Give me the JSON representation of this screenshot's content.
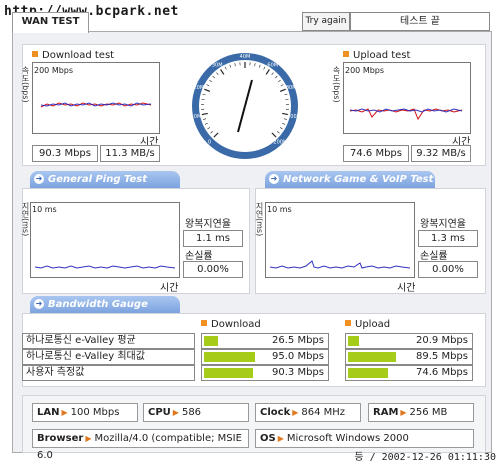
{
  "watermark": "http://www.bcpark.net",
  "tab": {
    "label": "WAN TEST"
  },
  "controls": {
    "retry": "Try again",
    "status": "테스트 끝"
  },
  "download": {
    "title": "Download test",
    "max": "200 Mbps",
    "axis_y": "속도(bps)",
    "axis_x": "시간",
    "mbps": "90.3 Mbps",
    "mbs": "11.3 MB/s"
  },
  "upload": {
    "title": "Upload test",
    "max": "200 Mbps",
    "axis_y": "속도(bps)",
    "axis_x": "시간",
    "mbps": "74.6 Mbps",
    "mbs": "9.32 MB/s"
  },
  "gauge": {
    "ticks": [
      "0",
      "10M",
      "20M",
      "30M",
      "40M",
      "60M",
      "80M",
      "100M",
      "200M"
    ]
  },
  "ping": {
    "title": "General Ping Test",
    "max": "10 ms",
    "axis_y": "지연(ms)",
    "axis_x": "시간",
    "rtt_label": "왕복지연율",
    "rtt": "1.1 ms",
    "loss_label": "손실률",
    "loss": "0.00%"
  },
  "game": {
    "title": "Network Game & VoIP Test",
    "max": "10 ms",
    "axis_y": "지연(ms)",
    "axis_x": "시간",
    "rtt_label": "왕복지연율",
    "rtt": "1.3 ms",
    "loss_label": "손실률",
    "loss": "0.00%"
  },
  "bandwidth": {
    "title": "Bandwidth Gauge",
    "download_label": "Download",
    "upload_label": "Upload",
    "rows": [
      {
        "label": "하나로통신 e-Valley 평균",
        "down": "26.5 Mbps",
        "down_frac": 0.265,
        "up": "20.9 Mbps",
        "up_frac": 0.209
      },
      {
        "label": "하나로통신 e-Valley 최대값",
        "down": "95.0 Mbps",
        "down_frac": 0.95,
        "up": "89.5 Mbps",
        "up_frac": 0.895
      },
      {
        "label": "사용자 측정값",
        "down": "90.3 Mbps",
        "down_frac": 0.903,
        "up": "74.6 Mbps",
        "up_frac": 0.746
      }
    ]
  },
  "sysinfo": {
    "lan_label": "LAN",
    "lan": "100 Mbps",
    "cpu_label": "CPU",
    "cpu": "586",
    "clock_label": "Clock",
    "clock": "864 MHz",
    "ram_label": "RAM",
    "ram": "256 MB",
    "browser_label": "Browser",
    "browser": "Mozilla/4.0 (compatible; MSIE 6.0",
    "os_label": "OS",
    "os": "Microsoft Windows 2000"
  },
  "timestamp": "등 / 2002-12-26 01:11:30",
  "colors": {
    "accent": "#f09020",
    "ribbon": "#7ca3de",
    "bar": "#a6cc1a"
  }
}
